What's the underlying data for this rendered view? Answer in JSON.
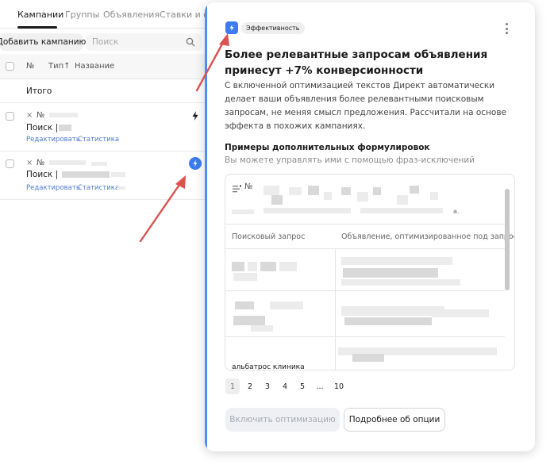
{
  "tabs": [
    {
      "label": "Кампании"
    },
    {
      "label": "Группы"
    },
    {
      "label": "Объявления"
    },
    {
      "label": "Ставки и фр"
    }
  ],
  "toolbar": {
    "add_campaign_label": "Добавить кампанию",
    "search_placeholder": "Поиск"
  },
  "table": {
    "col_no": "№",
    "col_type": "Тип",
    "col_type_sort": "↑",
    "col_name": "Название",
    "total_label": "Итого"
  },
  "campaigns": [
    {
      "x": "×",
      "no": "№",
      "name": "Поиск |",
      "edit": "Редактировать",
      "stats": "Статистика"
    },
    {
      "x": "×",
      "no": "№",
      "name": "Поиск |",
      "edit": "Редактировать",
      "stats": "Статистика"
    }
  ],
  "popup": {
    "badge": "Эффективность",
    "title": "Более релевантные запросам объявления принесут +7% конверсионности",
    "description": "С включенной оптимизацией текстов Директ автоматически делает ваши объявления более релевантными поисковым запросам, не меняя смысл предложения. Рассчитали на основе эффекта в похожих кампаниях.",
    "examples_title": "Примеры дополнительных формулировок",
    "examples_hint": "Вы можете управлять ими с помощью фраз-исключений",
    "example_no": "№",
    "example_tail": "а.",
    "col_query": "Поисковый запрос",
    "col_ad": "Объявление, оптимизированное под запрос",
    "last_query": "альбатрос клиника",
    "pages": [
      "1",
      "2",
      "3",
      "4",
      "5",
      "...",
      "10"
    ],
    "enable_label": "Включить оптимизацию",
    "more_label": "Подробнее об опции"
  },
  "colors": {
    "accent": "#3d7bf2",
    "popup_stripe": "#4c8df6",
    "arrow": "#d9534f",
    "link": "#4d7bd1"
  }
}
